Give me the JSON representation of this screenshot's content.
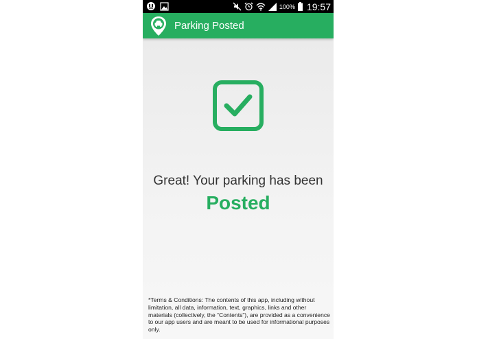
{
  "status_bar": {
    "battery_percent": "100%",
    "time": "19:57",
    "icons": [
      "notification-icon",
      "image-icon",
      "mute-icon",
      "alarm-icon",
      "wifi-icon",
      "signal-icon",
      "battery-icon"
    ]
  },
  "app_bar": {
    "title": "Parking Posted",
    "logo_icon": "parking-car-logo-icon"
  },
  "main": {
    "icon": "checkbox-checked-icon",
    "message": "Great! Your parking has been",
    "status": "Posted"
  },
  "terms": {
    "text": "*Terms & Conditions: The contents of this app, including without limitation, all data, information, text, graphics, links and other materials (collectively, the “Contents”), are provided as a convenience to our app users and are meant to be used for informational purposes only."
  },
  "colors": {
    "accent": "#27ae60",
    "status_bar": "#000000",
    "background": "#f0f0f0",
    "text": "#333333"
  }
}
